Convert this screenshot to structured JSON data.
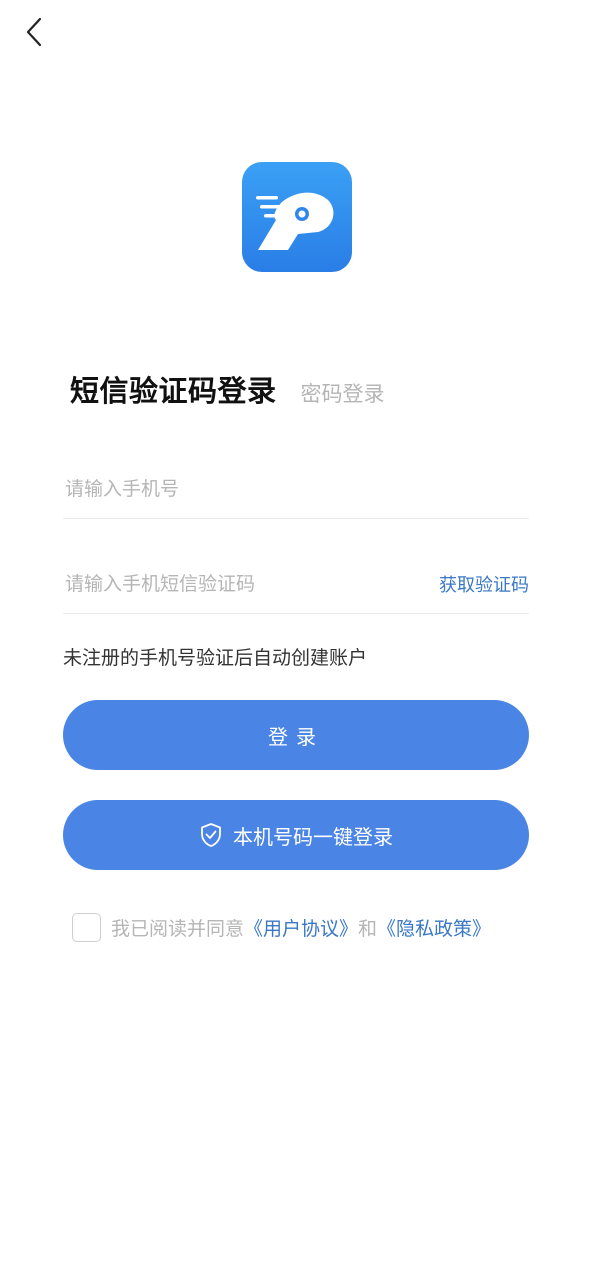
{
  "nav": {
    "back_icon": "chevron-left-icon"
  },
  "logo": {
    "icon": "parking-car-logo",
    "colors": [
      "#3aa0f5",
      "#2a7ee6"
    ]
  },
  "tabs": {
    "active": "短信验证码登录",
    "inactive": "密码登录"
  },
  "form": {
    "phone_placeholder": "请输入手机号",
    "code_placeholder": "请输入手机短信验证码",
    "get_code_label": "获取验证码"
  },
  "hint": "未注册的手机号验证后自动创建账户",
  "buttons": {
    "login_label": "登录",
    "onekey_label": "本机号码一键登录",
    "onekey_icon": "shield-check-icon"
  },
  "agreement": {
    "prefix": "我已阅读并同意",
    "user_agreement": "《用户协议》",
    "and": "和",
    "privacy_policy": "《隐私政策》",
    "checked": false
  },
  "colors": {
    "primary": "#4a84e4",
    "link": "#3a77c6",
    "placeholder": "#b5b5b5"
  }
}
